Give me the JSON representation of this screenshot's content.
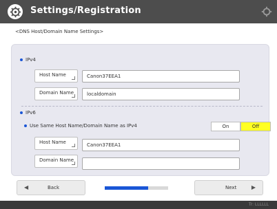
{
  "header": {
    "title": "Settings/Registration",
    "settings_icon": "gear-icon",
    "right_icon": "gear-icon"
  },
  "breadcrumb": "<DNS Host/Domain Name Settings>",
  "ipv4": {
    "label": "IPv4",
    "host_name_label": "Host Name",
    "host_name_value": "Canon37EEA1",
    "domain_name_label": "Domain Name",
    "domain_name_value": "localdomain"
  },
  "ipv6": {
    "label": "IPv6",
    "use_same_label": "Use Same Host Name/Domain Name as IPv4",
    "toggle_on": "On",
    "toggle_off": "Off",
    "selected": "Off",
    "host_name_label": "Host Name",
    "host_name_value": "Canon37EEA1",
    "domain_name_label": "Domain Name",
    "domain_name_value": ""
  },
  "nav": {
    "back_label": "Back",
    "next_label": "Next",
    "progress_fraction": 0.68
  },
  "footer": {
    "text": "Tr: LLLLLL"
  },
  "colors": {
    "accent": "#1a56d6",
    "selected_toggle": "#ffff22",
    "header": "#4d4d4d"
  }
}
